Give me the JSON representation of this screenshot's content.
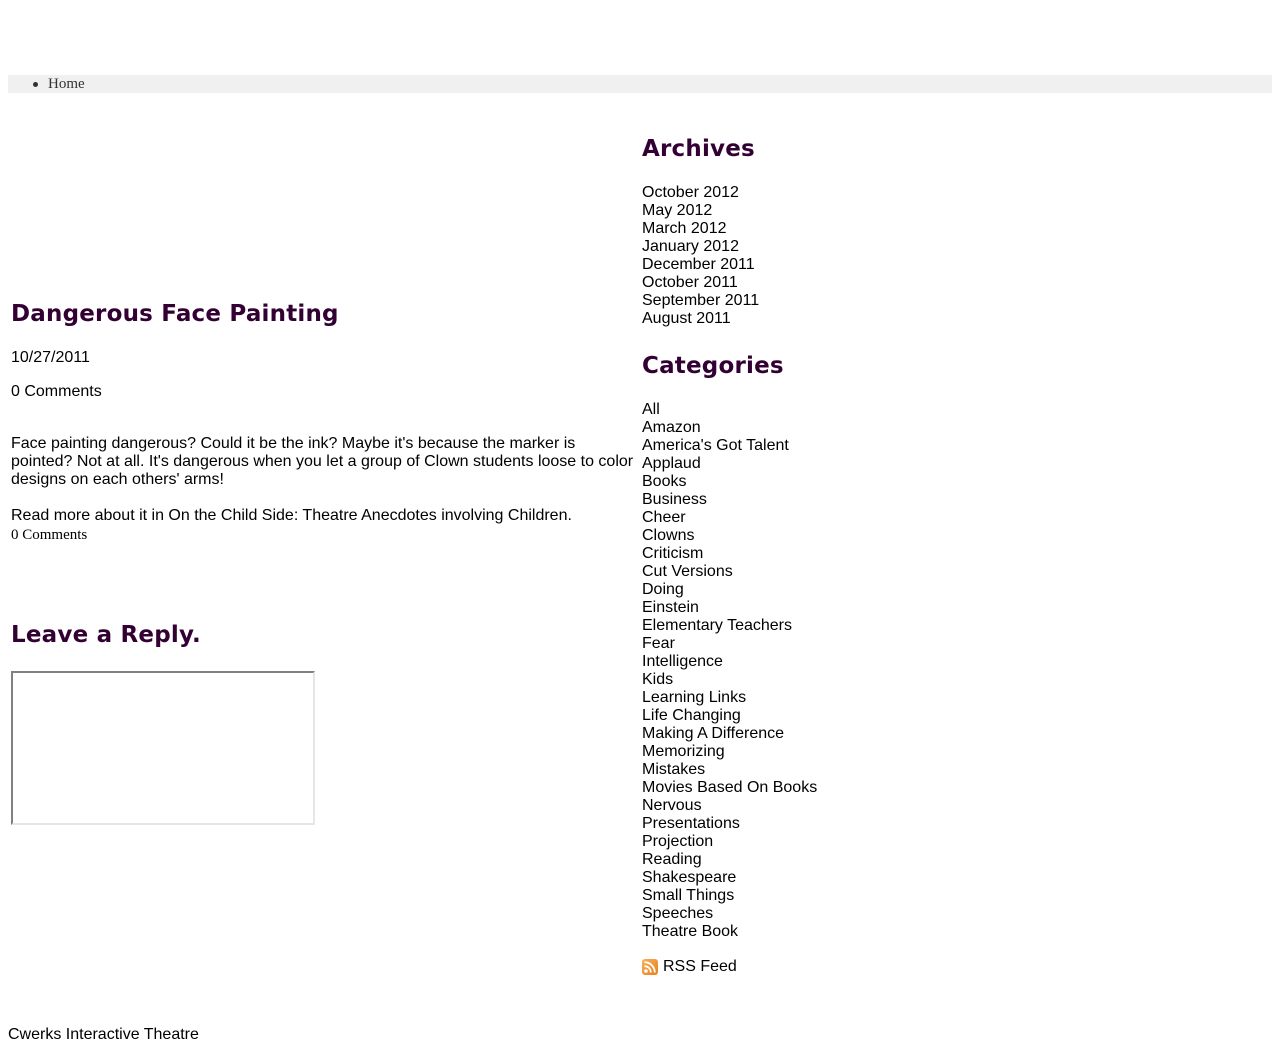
{
  "nav": {
    "items": [
      {
        "label": "Home"
      }
    ]
  },
  "post": {
    "title": "Dangerous Face Painting",
    "date": "10/27/2011",
    "comments_top": "0 Comments",
    "body": [
      "Face painting dangerous? Could it be the ink? Maybe it's because the marker is pointed? Not at all. It's dangerous when you let a group of Clown students loose to color designs on each others' arms!",
      "Read more about it in On the Child Side: Theatre Anecdotes involving Children."
    ],
    "comments_link": "0 Comments"
  },
  "reply": {
    "heading": "Leave a Reply."
  },
  "sidebar": {
    "archives_heading": "Archives",
    "archives": [
      "October 2012",
      "May 2012",
      "March 2012",
      "January 2012",
      "December 2011",
      "October 2011",
      "September 2011",
      "August 2011"
    ],
    "categories_heading": "Categories",
    "categories": [
      "All",
      "Amazon",
      "America's Got Talent",
      "Applaud",
      "Books",
      "Business",
      "Cheer",
      "Clowns",
      "Criticism",
      "Cut Versions",
      "Doing",
      "Einstein",
      "Elementary Teachers",
      "Fear",
      "Intelligence",
      "Kids",
      "Learning Links",
      "Life Changing",
      "Making A Difference",
      "Memorizing",
      "Mistakes",
      "Movies Based On Books",
      "Nervous",
      "Presentations",
      "Projection",
      "Reading",
      "Shakespeare",
      "Small Things",
      "Speeches",
      "Theatre Book"
    ],
    "rss": {
      "label": "RSS Feed",
      "icon": "rss-icon"
    }
  },
  "footer": {
    "text": "Cwerks Interactive Theatre"
  },
  "colors": {
    "heading": "#330033",
    "nav_background": "#f0f0f0"
  }
}
